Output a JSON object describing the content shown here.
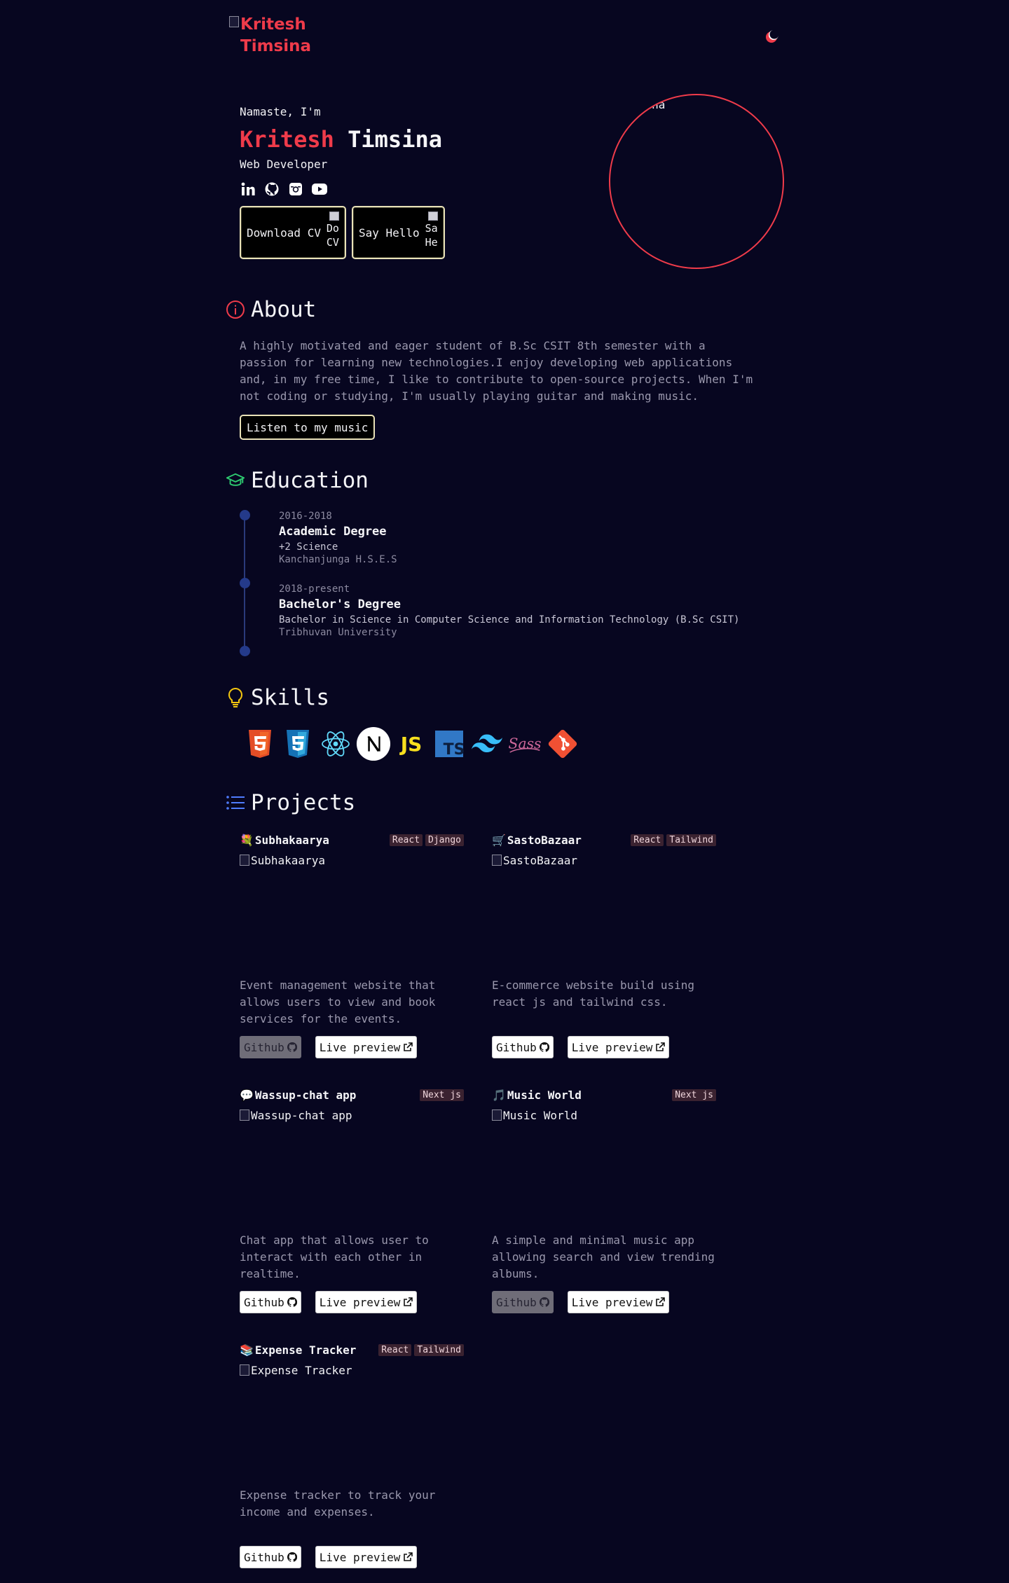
{
  "header": {
    "logo_alt": "Kritesh Timsina",
    "theme_icon": "moon-icon"
  },
  "hero": {
    "greeting": "Namaste, I'm",
    "first_name": "Kritesh",
    "last_name": "Timsina",
    "role": "Web Developer",
    "socials": [
      "linkedin-icon",
      "github-icon",
      "instagram-icon",
      "youtube-icon"
    ],
    "download_label": "Download CV",
    "download_alt": "Do CV",
    "hello_label": "Say Hello",
    "hello_alt": "Sa He",
    "avatar_alt": "sh Timsina"
  },
  "about": {
    "title": "About",
    "text": "A highly motivated and eager student of B.Sc CSIT 8th semester with a passion for learning new technologies.I enjoy developing web applications and, in my free time, I like to contribute to open-source projects. When I'm not coding or studying, I'm usually playing guitar and making music.",
    "music_button": "Listen to my music"
  },
  "education": {
    "title": "Education",
    "items": [
      {
        "years": "2016-2018",
        "degree": "Academic Degree",
        "field": "+2 Science",
        "school": "Kanchanjunga H.S.E.S"
      },
      {
        "years": "2018-present",
        "degree": "Bachelor's Degree",
        "field": "Bachelor in Science in Computer Science and Information Technology (B.Sc CSIT)",
        "school": "Tribhuvan University"
      }
    ]
  },
  "skills": {
    "title": "Skills",
    "items": [
      "html5-icon",
      "css3-icon",
      "react-icon",
      "nextjs-icon",
      "javascript-icon",
      "typescript-icon",
      "tailwind-icon",
      "sass-icon",
      "git-icon"
    ]
  },
  "projects": {
    "title": "Projects",
    "github_label": "Github",
    "preview_label": "Live preview",
    "items": [
      {
        "emoji": "💐",
        "name": "Subhakaarya",
        "tags": [
          "React",
          "Django"
        ],
        "image_alt": "Subhakaarya",
        "desc": "Event management website that allows users to view and book services for the events.",
        "github_disabled": true
      },
      {
        "emoji": "🛒",
        "name": "SastoBazaar",
        "tags": [
          "React",
          "Tailwind"
        ],
        "image_alt": "SastoBazaar",
        "desc": "E-commerce website build using react js and tailwind css.",
        "github_disabled": false
      },
      {
        "emoji": "💬",
        "name": "Wassup-chat app",
        "tags": [
          "Next js"
        ],
        "image_alt": "Wassup-chat app",
        "desc": "Chat app that allows user to interact with each other in realtime.",
        "github_disabled": false
      },
      {
        "emoji": "🎵",
        "name": "Music World",
        "tags": [
          "Next js"
        ],
        "image_alt": "Music World",
        "desc": "A simple and minimal music app allowing search and view trending albums.",
        "github_disabled": true
      },
      {
        "emoji": "📚",
        "name": "Expense Tracker",
        "tags": [
          "React",
          "Tailwind"
        ],
        "image_alt": "Expense Tracker",
        "desc": "Expense tracker to track your income and expenses.",
        "github_disabled": false
      }
    ]
  },
  "colors": {
    "background": "#070620",
    "accent": "#ef3b4a",
    "muted_text": "#9a98ad",
    "button_border": "#e9e2b8",
    "timeline": "#243a8a"
  }
}
